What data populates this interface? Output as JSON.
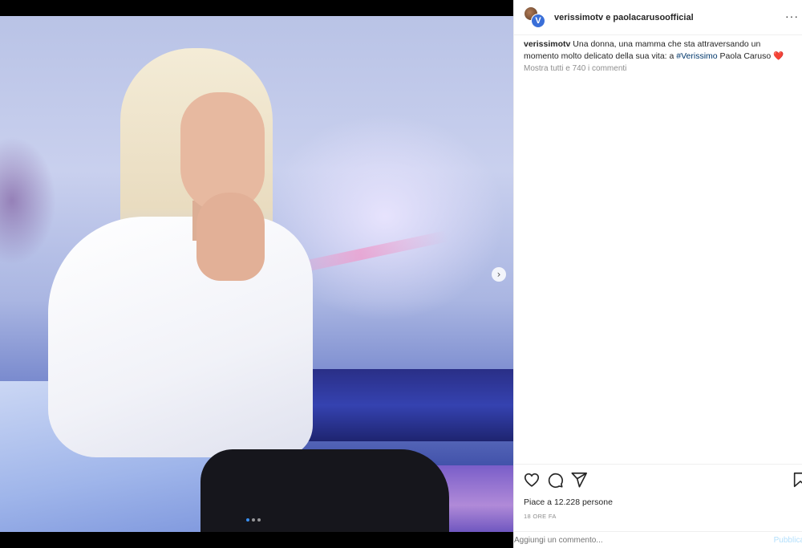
{
  "post": {
    "header_title": "verissimotv e paolacarusoofficial",
    "avatar_letter": "V",
    "more_label": "···"
  },
  "caption": {
    "username": "verissimotv",
    "text_before": " Una donna, una mamma che sta attraversando un momento molto delicato della sua vita: a ",
    "hashtag": "#Verissimo",
    "text_after": " Paola Caruso ",
    "emoji": "❤️"
  },
  "comments_link": "Mostra tutti e 740 i commenti",
  "likes": "Piace a 12.228 persone",
  "timestamp": "18 ORE FA",
  "comment_box": {
    "placeholder": "Aggiungi un commento...",
    "publish_label": "Pubblica"
  },
  "carousel": {
    "next_glyph": "›",
    "dots": 3,
    "active_index": 0
  },
  "icons": [
    "heart-icon",
    "comment-icon",
    "share-icon",
    "bookmark-icon"
  ],
  "colors": {
    "link": "#00376b",
    "publish": "#b2dffc",
    "active_dot": "#3a8ff0"
  }
}
